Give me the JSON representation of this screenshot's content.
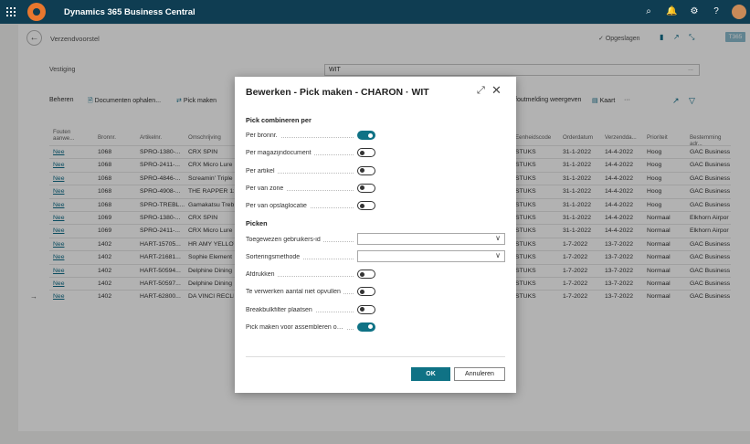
{
  "app": {
    "title": "Dynamics 365 Business Central"
  },
  "page": {
    "title": "Verzendvoorstel",
    "saved_status": "Opgeslagen",
    "badge": "T365",
    "location_label": "Vestiging",
    "location_value": "WIT",
    "location_dots": "..."
  },
  "actions": {
    "process": "Beheren",
    "get_documents": "Documenten ophalen...",
    "create_pick": "Pick maken",
    "show_message": "foutmelding weergeven",
    "card": "Kaart",
    "more": "···"
  },
  "grid": {
    "headers": {
      "errors": "Fouten aanwe...",
      "source_no": "Bronnr.",
      "item_no": "Artikelnr.",
      "description": "Omschrijving",
      "uom": "Eenheidscode",
      "order_date": "Orderdatum",
      "ship_date": "Verzendda...",
      "priority": "Prioriteit",
      "destination": "Bestemming adr..."
    },
    "rows": [
      {
        "err": "Nee",
        "src": "1068",
        "item": "SPRO-1380-...",
        "desc": "CRX SPIN",
        "uom": "STUKS",
        "od": "31-1-2022",
        "sd": "14-4-2022",
        "prio": "Hoog",
        "dest": "GAC Business T"
      },
      {
        "err": "Nee",
        "src": "1068",
        "item": "SPRO-2411-...",
        "desc": "CRX Micro Lure",
        "uom": "STUKS",
        "od": "31-1-2022",
        "sd": "14-4-2022",
        "prio": "Hoog",
        "dest": "GAC Business T"
      },
      {
        "err": "Nee",
        "src": "1068",
        "item": "SPRO-4846-...",
        "desc": "Screamin' Triple",
        "uom": "STUKS",
        "od": "31-1-2022",
        "sd": "14-4-2022",
        "prio": "Hoog",
        "dest": "GAC Business T"
      },
      {
        "err": "Nee",
        "src": "1068",
        "item": "SPRO-4908-...",
        "desc": "THE RAPPER 12",
        "uom": "STUKS",
        "od": "31-1-2022",
        "sd": "14-4-2022",
        "prio": "Hoog",
        "dest": "GAC Business T"
      },
      {
        "err": "Nee",
        "src": "1068",
        "item": "SPRO-TREBL...",
        "desc": "Gamakatsu Treble",
        "uom": "STUKS",
        "od": "31-1-2022",
        "sd": "14-4-2022",
        "prio": "Hoog",
        "dest": "GAC Business T"
      },
      {
        "err": "Nee",
        "src": "1069",
        "item": "SPRO-1380-...",
        "desc": "CRX SPIN",
        "uom": "STUKS",
        "od": "31-1-2022",
        "sd": "14-4-2022",
        "prio": "Normaal",
        "dest": "Elkhorn Airpor"
      },
      {
        "err": "Nee",
        "src": "1069",
        "item": "SPRO-2411-...",
        "desc": "CRX Micro Lure",
        "uom": "STUKS",
        "od": "31-1-2022",
        "sd": "14-4-2022",
        "prio": "Normaal",
        "dest": "Elkhorn Airpor"
      },
      {
        "err": "Nee",
        "src": "1402",
        "item": "HART-15705...",
        "desc": "HR AMY YELLOW",
        "uom": "STUKS",
        "od": "1-7-2022",
        "sd": "13-7-2022",
        "prio": "Normaal",
        "dest": "GAC Business T"
      },
      {
        "err": "Nee",
        "src": "1402",
        "item": "HART-21681...",
        "desc": "Sophie Element",
        "uom": "STUKS",
        "od": "1-7-2022",
        "sd": "13-7-2022",
        "prio": "Normaal",
        "dest": "GAC Business T"
      },
      {
        "err": "Nee",
        "src": "1402",
        "item": "HART-50594...",
        "desc": "Delphine Dining",
        "uom": "STUKS",
        "od": "1-7-2022",
        "sd": "13-7-2022",
        "prio": "Normaal",
        "dest": "GAC Business T"
      },
      {
        "err": "Nee",
        "src": "1402",
        "item": "HART-50597...",
        "desc": "Delphine Dining",
        "uom": "STUKS",
        "od": "1-7-2022",
        "sd": "13-7-2022",
        "prio": "Normaal",
        "dest": "GAC Business T"
      },
      {
        "err": "Nee",
        "src": "1402",
        "item": "HART-62800...",
        "desc": "DA VINCI RECLI",
        "uom": "STUKS",
        "od": "1-7-2022",
        "sd": "13-7-2022",
        "prio": "Normaal",
        "dest": "GAC Business T"
      }
    ]
  },
  "dialog": {
    "title": "Bewerken - Pick maken - CHARON · WIT",
    "section1": "Pick combineren per",
    "options1": [
      {
        "label": "Per bronnr.",
        "on": true
      },
      {
        "label": "Per magazijndocument",
        "on": false
      },
      {
        "label": "Per artikel",
        "on": false
      },
      {
        "label": "Per van zone",
        "on": false
      },
      {
        "label": "Per van opslaglocatie",
        "on": false
      }
    ],
    "section2": "Picken",
    "assigned_user_label": "Toegewezen gebruikers-id",
    "assigned_user_value": "",
    "sorting_label": "Sorteringsmethode",
    "sorting_value": "",
    "options2": [
      {
        "label": "Afdrukken",
        "on": false
      },
      {
        "label": "Te verwerken aantal niet opvullen",
        "on": false
      },
      {
        "label": "Breakbulkfilter plaatsen",
        "on": false
      },
      {
        "label": "Pick maken voor assembleren op...",
        "on": true
      }
    ],
    "ok": "OK",
    "cancel": "Annuleren"
  }
}
